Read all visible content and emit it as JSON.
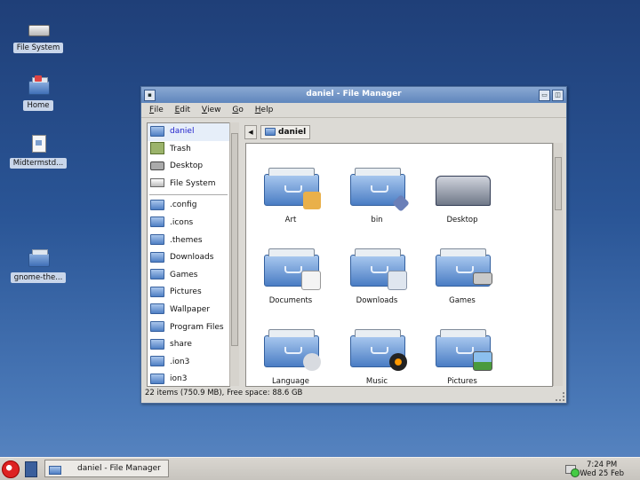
{
  "desktop": {
    "icons": [
      {
        "label": "File System"
      },
      {
        "label": "Home"
      },
      {
        "label": "Midtermstd..."
      },
      {
        "label": "gnome-the..."
      }
    ]
  },
  "window": {
    "title": "daniel - File Manager",
    "menu": [
      "File",
      "Edit",
      "View",
      "Go",
      "Help"
    ],
    "menu_mnemonics": [
      "F",
      "E",
      "V",
      "G",
      "H"
    ],
    "sidebar": {
      "places": [
        "daniel",
        "Trash",
        "Desktop",
        "File System"
      ],
      "folders": [
        ".config",
        ".icons",
        ".themes",
        "Downloads",
        "Games",
        "Pictures",
        "Wallpaper",
        "Program Files",
        "share",
        ".ion3",
        "ion3"
      ]
    },
    "path": {
      "current": "daniel"
    },
    "items": [
      "Art",
      "bin",
      "Desktop",
      "Documents",
      "Downloads",
      "Games",
      "Language",
      "Music",
      "Pictures"
    ],
    "status": "22 items (750.9 MB), Free space: 88.6 GB"
  },
  "taskbar": {
    "task_label": "daniel - File Manager",
    "time": "7:24 PM",
    "date": "Wed 25 Feb"
  }
}
